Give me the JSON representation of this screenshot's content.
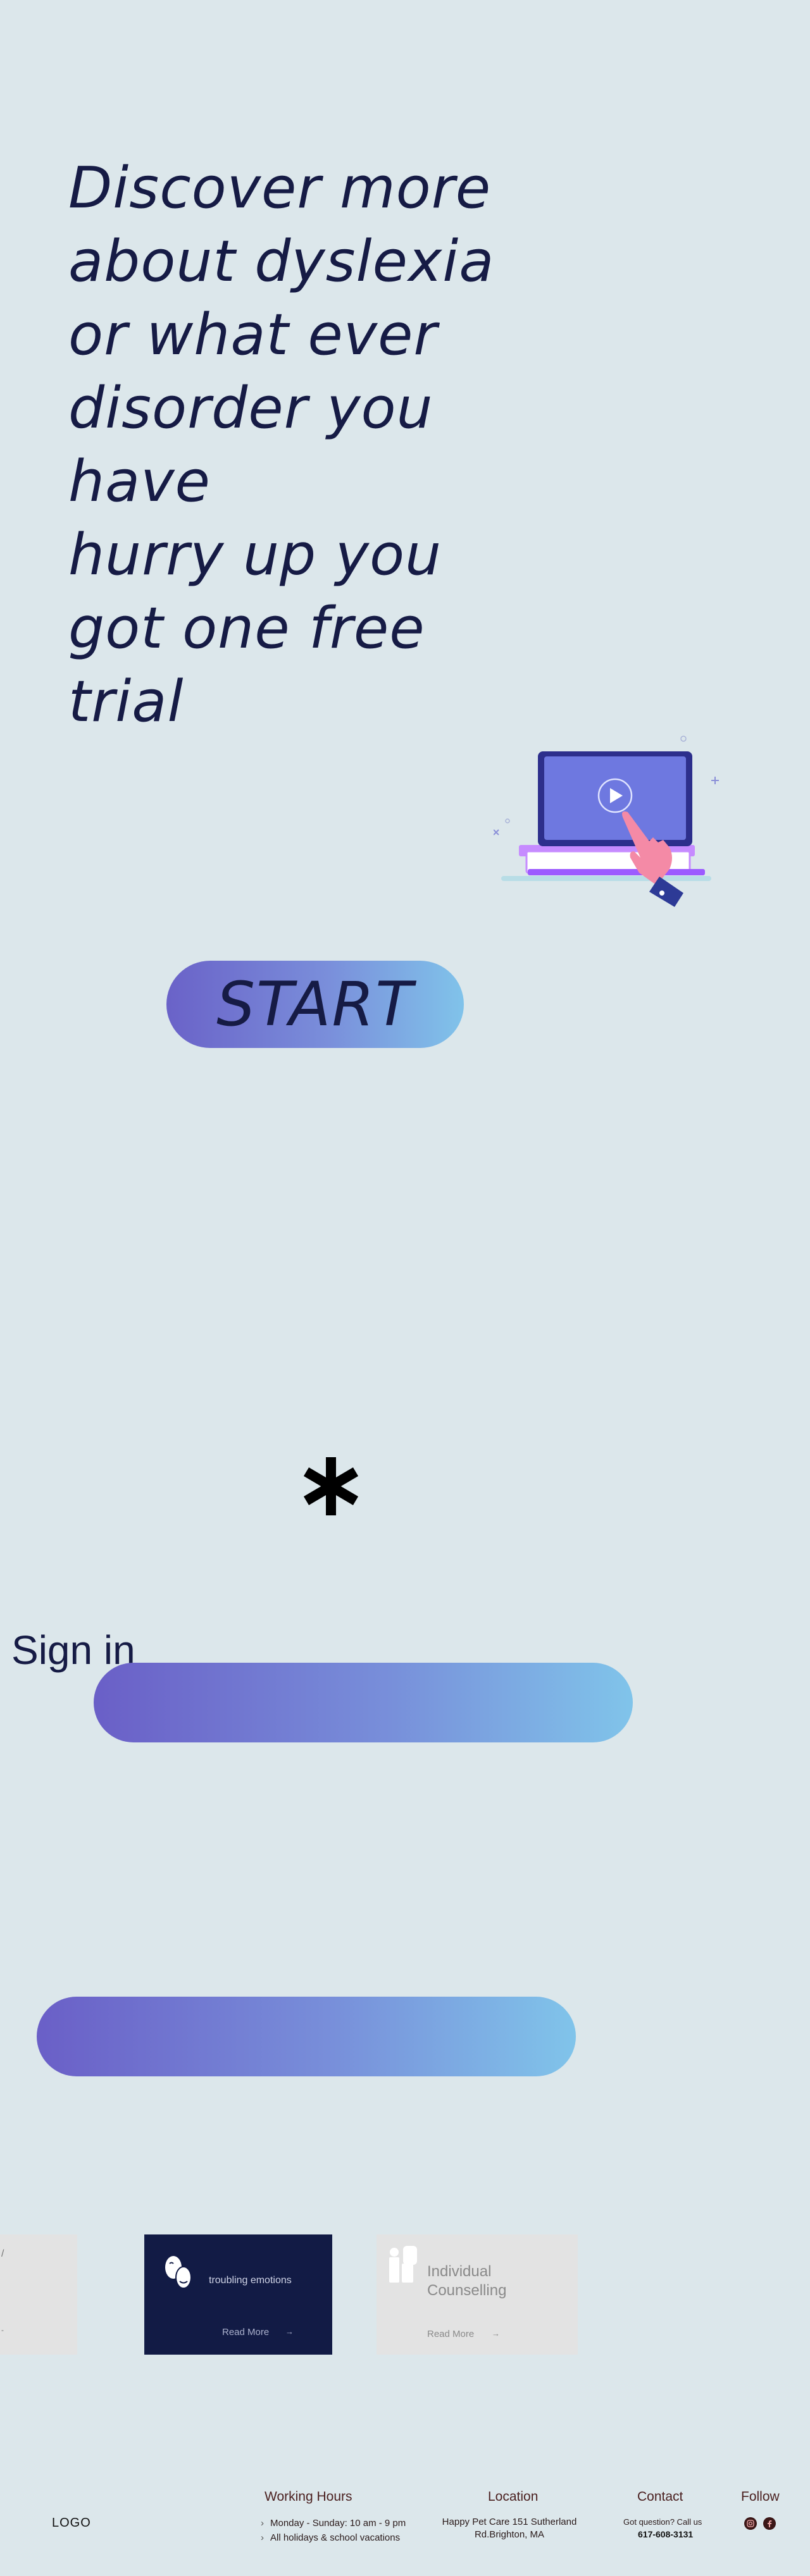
{
  "hero": {
    "heading": "Discover more\nabout dyslexia\nor what ever\ndisorder you\nhave\n hurry up you\ngot one free\ntrial"
  },
  "cta": {
    "start_label": "START"
  },
  "auth": {
    "sign_in_label": "Sign in"
  },
  "cards": [
    {
      "frag_top": "/",
      "frag_bottom": "-"
    },
    {
      "label": "troubling emotions",
      "more": "Read More",
      "arrow": "→"
    },
    {
      "label": "Individual Counselling",
      "more": "Read More",
      "arrow": "→"
    }
  ],
  "footer": {
    "logo": "LOGO",
    "working_hours": {
      "heading": "Working Hours",
      "items": [
        "Monday - Sunday: 10 am - 9 pm",
        "All holidays & school vacations"
      ]
    },
    "location": {
      "heading": "Location",
      "address": "Happy Pet Care 151 Sutherland Rd.Brighton, MA"
    },
    "contact": {
      "heading": "Contact",
      "question": "Got question? Call us",
      "phone": "617-608-3131"
    },
    "follow": {
      "heading": "Follow",
      "icons": [
        "instagram-icon",
        "facebook-icon"
      ]
    }
  },
  "colors": {
    "background": "#dce7eb",
    "text_dark": "#161b45",
    "gradient_start": "#6a5fc7",
    "gradient_end": "#80c4ea",
    "card_dark": "#121b45",
    "card_light": "#e3e3e3"
  }
}
